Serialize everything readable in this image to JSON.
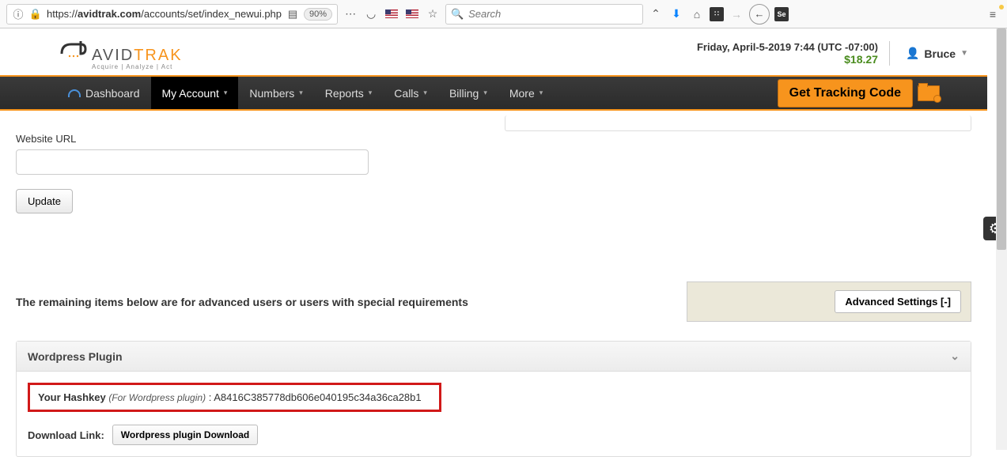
{
  "browser": {
    "url_prefix": "https://",
    "url_domain": "avidtrak.com",
    "url_path": "/accounts/set/index_newui.php",
    "zoom": "90%",
    "search_placeholder": "Search"
  },
  "header": {
    "logo_main": "AVID",
    "logo_trak": "TRAK",
    "logo_tag": "Acquire | Analyze | Act",
    "datetime": "Friday, April-5-2019 7:44 (UTC -07:00)",
    "balance": "$18.27",
    "user": "Bruce"
  },
  "nav": {
    "items": [
      {
        "label": "Dashboard"
      },
      {
        "label": "My Account"
      },
      {
        "label": "Numbers"
      },
      {
        "label": "Reports"
      },
      {
        "label": "Calls"
      },
      {
        "label": "Billing"
      },
      {
        "label": "More"
      }
    ],
    "tracking_btn": "Get Tracking Code"
  },
  "form": {
    "website_label": "Website URL",
    "update_btn": "Update"
  },
  "advanced": {
    "message": "The remaining items below are for advanced users or users with special requirements",
    "btn": "Advanced Settings [-]"
  },
  "panel": {
    "title": "Wordpress Plugin",
    "hash_label": "Your Hashkey ",
    "hash_sub": "(For Wordpress plugin)",
    "hash_sep": " :  ",
    "hash_value": "A8416C385778db606e040195c34a36ca28b1",
    "dl_label": "Download Link:",
    "dl_btn": "Wordpress plugin Download"
  }
}
